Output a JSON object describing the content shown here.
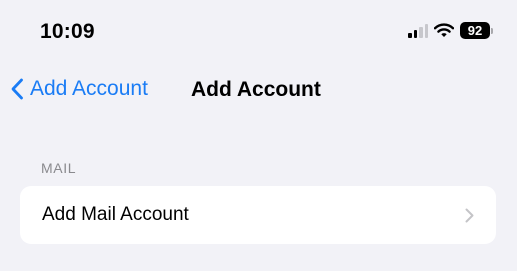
{
  "status_bar": {
    "time": "10:09",
    "battery_level": "92",
    "signal_bars_active": 2,
    "signal_bars_total": 4,
    "icons": [
      "cellular-signal-icon",
      "wifi-icon",
      "battery-icon"
    ]
  },
  "nav": {
    "back_label": "Add Account",
    "title": "Add Account",
    "back_icon": "chevron-left-icon"
  },
  "section": {
    "header": "MAIL",
    "rows": [
      {
        "label": "Add Mail Account",
        "icon": "chevron-right-icon"
      }
    ]
  },
  "colors": {
    "background": "#f2f2f7",
    "accent": "#1a7cf5",
    "card": "#ffffff",
    "secondary_text": "#8a8a8e"
  }
}
